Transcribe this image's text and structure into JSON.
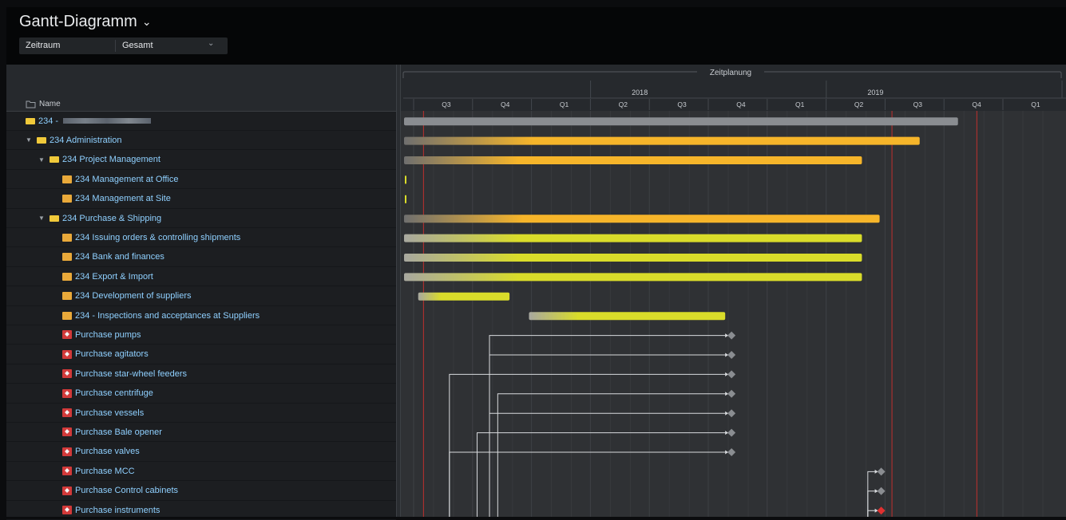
{
  "header": {
    "title": "Gantt-Diagramm",
    "chevron": "⌄"
  },
  "filter": {
    "label": "Zeitraum",
    "value": "Gesamt",
    "caret": "⌄"
  },
  "tree": {
    "column_label": "Name",
    "rows": [
      {
        "label": "234 -",
        "level": 0,
        "icon": "folder-icon",
        "expander": false,
        "redacted": true
      },
      {
        "label": "234 Administration",
        "level": 0,
        "icon": "folder-icon",
        "expander": true
      },
      {
        "label": "234 Project Management",
        "level": 1,
        "icon": "folder-icon",
        "expander": true
      },
      {
        "label": "234 Management at Office",
        "level": 2,
        "icon": "task-icon",
        "expander": false
      },
      {
        "label": "234 Management at Site",
        "level": 2,
        "icon": "task-icon",
        "expander": false
      },
      {
        "label": "234 Purchase & Shipping",
        "level": 1,
        "icon": "folder-icon",
        "expander": true
      },
      {
        "label": "234 Issuing orders & controlling shipments",
        "level": 2,
        "icon": "task-icon",
        "expander": false
      },
      {
        "label": "234 Bank and finances",
        "level": 2,
        "icon": "task-icon",
        "expander": false
      },
      {
        "label": "234 Export & Import",
        "level": 2,
        "icon": "task-icon",
        "expander": false
      },
      {
        "label": "234 Development of suppliers",
        "level": 2,
        "icon": "task-icon",
        "expander": false
      },
      {
        "label": "234 - Inspections and acceptances at Suppliers",
        "level": 2,
        "icon": "task-icon",
        "expander": false
      },
      {
        "label": "Purchase pumps",
        "level": 2,
        "icon": "milestone-icon",
        "expander": false
      },
      {
        "label": "Purchase agitators",
        "level": 2,
        "icon": "milestone-icon",
        "expander": false
      },
      {
        "label": "Purchase star-wheel feeders",
        "level": 2,
        "icon": "milestone-icon",
        "expander": false
      },
      {
        "label": "Purchase centrifuge",
        "level": 2,
        "icon": "milestone-icon",
        "expander": false
      },
      {
        "label": "Purchase vessels",
        "level": 2,
        "icon": "milestone-icon",
        "expander": false
      },
      {
        "label": "Purchase Bale opener",
        "level": 2,
        "icon": "milestone-icon",
        "expander": false
      },
      {
        "label": "Purchase valves",
        "level": 2,
        "icon": "milestone-icon",
        "expander": false
      },
      {
        "label": "Purchase MCC",
        "level": 2,
        "icon": "milestone-icon",
        "expander": false
      },
      {
        "label": "Purchase Control cabinets",
        "level": 2,
        "icon": "milestone-icon",
        "expander": false
      },
      {
        "label": "Purchase instruments",
        "level": 2,
        "icon": "milestone-icon",
        "expander": false
      }
    ]
  },
  "timeline": {
    "group_label": "Zeitplanung",
    "years": [
      "2018",
      "2019"
    ],
    "quarters": [
      "Q3",
      "Q4",
      "Q1",
      "Q2",
      "Q3",
      "Q4",
      "Q1",
      "Q2",
      "Q3",
      "Q4",
      "Q1"
    ]
  },
  "bars": [
    {
      "row": 0,
      "start": 0.0,
      "end": 9.4,
      "style": "gray"
    },
    {
      "row": 1,
      "start": 0.0,
      "end": 8.75,
      "style": "orange"
    },
    {
      "row": 2,
      "start": 0.0,
      "end": 7.77,
      "style": "orange"
    },
    {
      "row": 3,
      "start": 0.0,
      "end": 0.03,
      "style": "tick"
    },
    {
      "row": 4,
      "start": 0.0,
      "end": 0.03,
      "style": "tick"
    },
    {
      "row": 5,
      "start": 0.0,
      "end": 8.07,
      "style": "orange"
    },
    {
      "row": 6,
      "start": 0.0,
      "end": 7.77,
      "style": "yellow"
    },
    {
      "row": 7,
      "start": 0.0,
      "end": 7.77,
      "style": "yellow"
    },
    {
      "row": 8,
      "start": 0.0,
      "end": 7.77,
      "style": "yellow"
    },
    {
      "row": 9,
      "start": 0.24,
      "end": 1.79,
      "style": "yellow"
    },
    {
      "row": 10,
      "start": 2.12,
      "end": 5.45,
      "style": "yellow"
    }
  ],
  "milestones": [
    {
      "row": 11,
      "at": 5.53,
      "color": "#8a8d91",
      "src": 1.45
    },
    {
      "row": 12,
      "at": 5.53,
      "color": "#8a8d91",
      "src": 1.45
    },
    {
      "row": 13,
      "at": 5.53,
      "color": "#8a8d91",
      "src": 0.77
    },
    {
      "row": 14,
      "at": 5.53,
      "color": "#8a8d91",
      "src": 1.59
    },
    {
      "row": 15,
      "at": 5.53,
      "color": "#8a8d91",
      "src": 1.45
    },
    {
      "row": 16,
      "at": 5.53,
      "color": "#8a8d91",
      "src": 1.24
    },
    {
      "row": 17,
      "at": 5.53,
      "color": "#8a8d91",
      "src": 0.77
    },
    {
      "row": 18,
      "at": 8.07,
      "color": "#8a8d91",
      "src": 7.87
    },
    {
      "row": 19,
      "at": 8.07,
      "color": "#8a8d91",
      "src": 7.87
    },
    {
      "row": 20,
      "at": 8.07,
      "color": "#e03030",
      "src": 7.87
    }
  ],
  "red_lines": [
    0.33,
    8.28,
    9.72
  ],
  "colors": {
    "gray_bar": "#8a8d91",
    "orange_bar": "#f6b52a",
    "yellow_bar": "#d9dc2a",
    "red_line": "#c0302e",
    "link_line": "#d8dadd"
  }
}
